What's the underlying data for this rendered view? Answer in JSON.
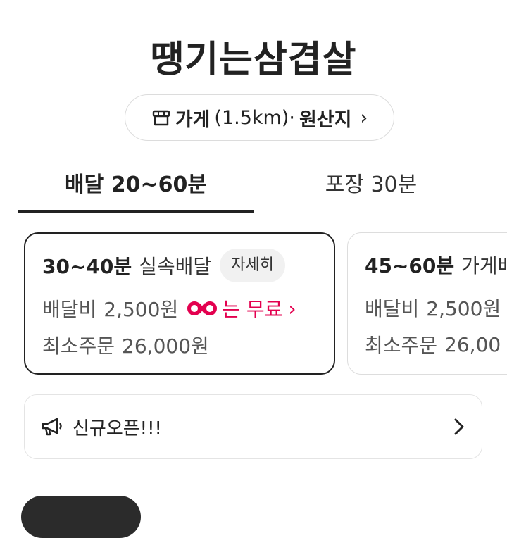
{
  "store": {
    "name": "땡기는삼겹살",
    "info_pill": {
      "icon": "store-icon",
      "label_bold": "가게",
      "distance": "(1.5km)·",
      "origin": "원산지",
      "chevron": "›"
    }
  },
  "tabs": [
    {
      "label": "배달 20~60분",
      "active": true
    },
    {
      "label": "포장 30분",
      "active": false
    }
  ],
  "delivery_options": [
    {
      "time": "30~40분",
      "method": "실속배달",
      "detail_label": "자세히",
      "fee_label": "배달비",
      "fee": "2,500원",
      "promo_suffix": "는 무료",
      "promo_chevron": "›",
      "min_label": "최소주문",
      "min_order": "26,000원"
    },
    {
      "time": "45~60분",
      "method": "가게배",
      "fee_label": "배달비",
      "fee": "2,500원",
      "min_label": "최소주문",
      "min_order": "26,00"
    }
  ],
  "notice": {
    "icon": "megaphone-icon",
    "text": "신규오픈!!!",
    "chevron": "chevron-right-icon"
  },
  "colors": {
    "promo": "#e3004f",
    "text": "#222222",
    "border": "#dddddd"
  }
}
